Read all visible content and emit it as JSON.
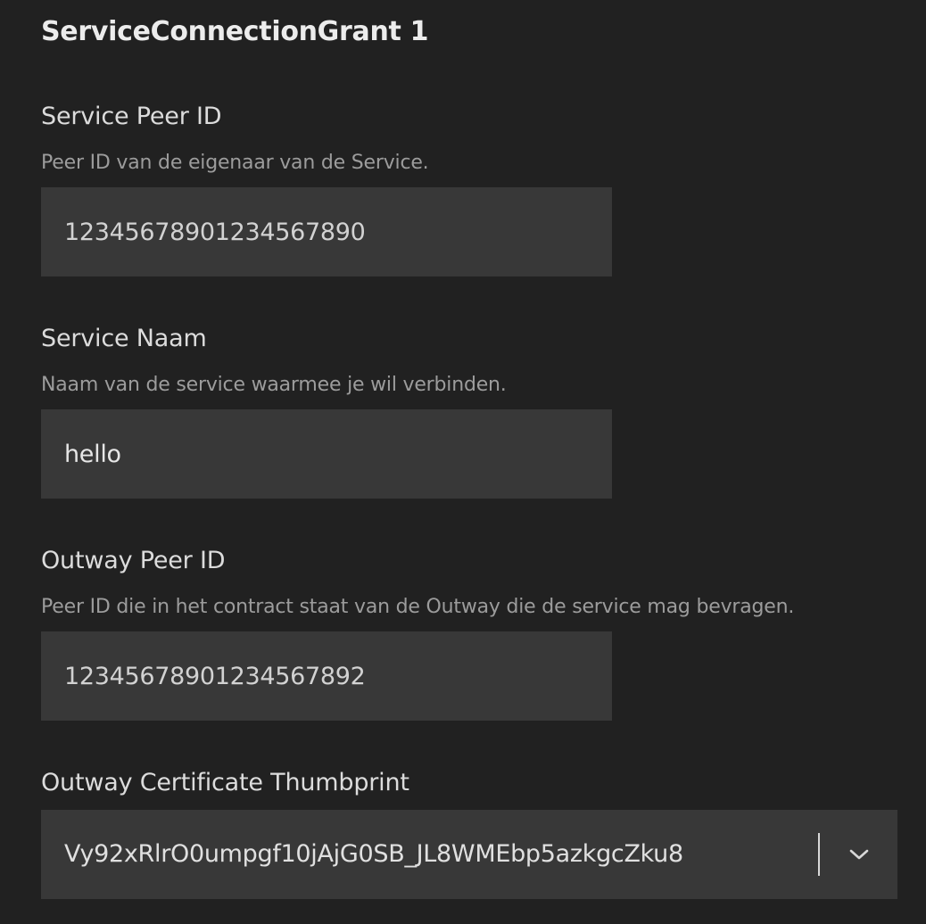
{
  "grant": {
    "title": "ServiceConnectionGrant 1"
  },
  "fields": {
    "service_peer_id": {
      "label": "Service Peer ID",
      "hint": "Peer ID van de eigenaar van de Service.",
      "value": "12345678901234567890"
    },
    "service_name": {
      "label": "Service Naam",
      "hint": "Naam van de service waarmee je wil verbinden.",
      "value": "hello"
    },
    "outway_peer_id": {
      "label": "Outway Peer ID",
      "hint": "Peer ID die in het contract staat van de Outway die de service mag bevragen.",
      "value": "12345678901234567892"
    },
    "outway_cert_thumbprint": {
      "label": "Outway Certificate Thumbprint",
      "selected": "Vy92xRlrO0umpgf10jAjG0SB_JL8WMEbp5azkgcZku8",
      "toggle_icon": "chevron-down-icon"
    }
  },
  "colors": {
    "background": "#212121",
    "input_background": "#383838",
    "label": "#dcdcdc",
    "hint": "#9c9c9c",
    "value": "#d2d2d2"
  }
}
